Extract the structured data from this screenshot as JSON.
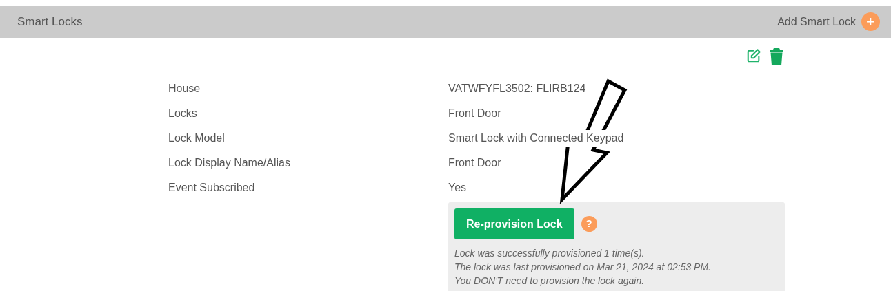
{
  "panel": {
    "title": "Smart Locks",
    "add_action": {
      "label": "Add Smart Lock",
      "icon": "+"
    }
  },
  "details": [
    {
      "label": "House",
      "value": "VATWFYFL3502: FLIRB124"
    },
    {
      "label": "Locks",
      "value": "Front Door"
    },
    {
      "label": "Lock Model",
      "value": "Smart Lock with Connected Keypad"
    },
    {
      "label": "Lock Display Name/Alias",
      "value": "Front Door"
    },
    {
      "label": "Event Subscribed",
      "value": "Yes"
    }
  ],
  "reprovision": {
    "button": "Re-provision Lock",
    "help": "?",
    "notes": [
      "Lock was successfully provisioned 1 time(s).",
      "The lock was last provisioned on Mar 21, 2024 at 02:53 PM.",
      "You DON'T need to provision the lock again."
    ]
  }
}
